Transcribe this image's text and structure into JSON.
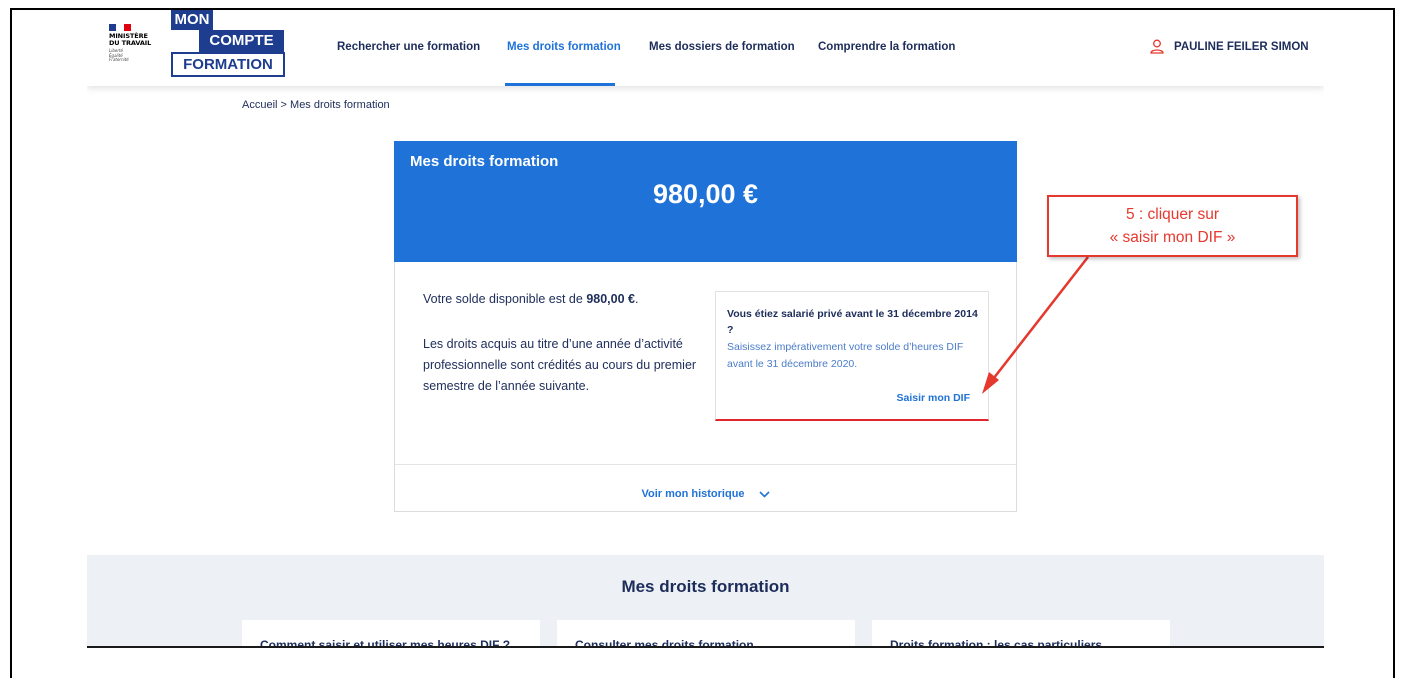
{
  "header": {
    "ministry": {
      "line1": "MINISTÈRE",
      "line2": "DU TRAVAIL",
      "motto": [
        "Liberté",
        "Égalité",
        "Fraternité"
      ]
    },
    "logo": {
      "line1": "MON",
      "line2": "COMPTE",
      "line3": "FORMATION"
    },
    "nav": [
      {
        "label": "Rechercher une formation",
        "active": false
      },
      {
        "label": "Mes droits formation",
        "active": true
      },
      {
        "label": "Mes dossiers de formation",
        "active": false
      },
      {
        "label": "Comprendre la formation",
        "active": false
      }
    ],
    "user": {
      "name": "PAULINE FEILER SIMON",
      "icon": "user-icon"
    }
  },
  "breadcrumb": {
    "home": "Accueil",
    "separator": ">",
    "current": "Mes droits formation"
  },
  "card": {
    "title": "Mes droits formation",
    "amount": "980,00 €",
    "solde_prefix": "Votre solde disponible est de ",
    "solde_value": "980,00 €",
    "solde_suffix": ".",
    "droits_text": "Les droits acquis au titre d’une année d’activité professionnelle sont crédités au cours du premier semestre de l’année suivante.",
    "dif": {
      "title": "Vous étiez salarié privé avant le 31 décembre 2014 ?",
      "text": "Saisissez impérativement votre solde d’heures DIF avant le 31 décembre 2020.",
      "link": "Saisir mon DIF"
    },
    "history_link": "Voir mon historique"
  },
  "bottom": {
    "title": "Mes droits formation",
    "tiles": [
      "Comment saisir et utiliser mes heures DIF ?",
      "Consulter mes droits formation",
      "Droits formation : les cas particuliers"
    ]
  },
  "annotation": {
    "line1": "5 : cliquer sur",
    "line2": "« saisir mon DIF »"
  },
  "colors": {
    "primary": "#1f72d8",
    "navy": "#1d2d5a",
    "annotation": "#e5382e",
    "logo_blue": "#1e3d8f"
  }
}
